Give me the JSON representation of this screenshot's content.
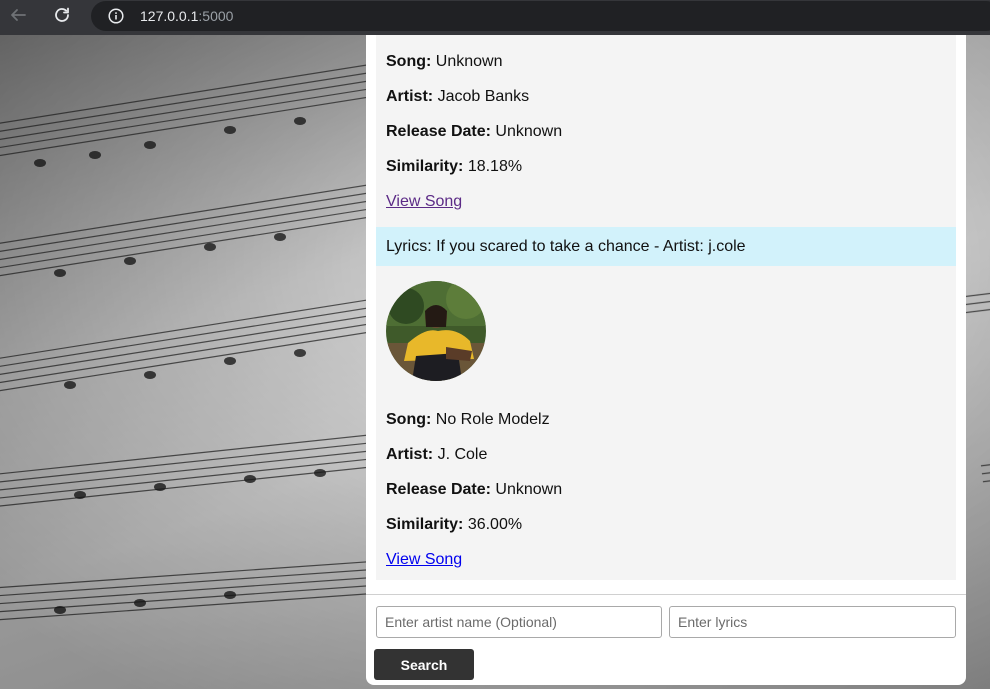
{
  "browser": {
    "url_host": "127.0.0.1",
    "url_port": ":5000",
    "icons": {
      "back": "arrow-left-icon",
      "reload": "reload-icon",
      "info": "info-icon"
    }
  },
  "results": [
    {
      "song_label": "Song:",
      "song": "Unknown",
      "artist_label": "Artist:",
      "artist": "Jacob Banks",
      "release_label": "Release Date:",
      "release": "Unknown",
      "similarity_label": "Similarity:",
      "similarity": "18.18%",
      "view_link": "View Song"
    },
    {
      "header": "Lyrics: If you scared to take a chance - Artist: j.cole",
      "song_label": "Song:",
      "song": "No Role Modelz",
      "artist_label": "Artist:",
      "artist": "J. Cole",
      "release_label": "Release Date:",
      "release": "Unknown",
      "similarity_label": "Similarity:",
      "similarity": "36.00%",
      "view_link": "View Song"
    }
  ],
  "search": {
    "artist_placeholder": "Enter artist name (Optional)",
    "artist_value": "",
    "lyrics_placeholder": "Enter lyrics",
    "lyrics_value": "",
    "button_label": "Search"
  },
  "colors": {
    "highlight": "#d2f2fb",
    "panel": "#f4f4f4",
    "button": "#333333",
    "visited_link": "#5b2a86",
    "link": "#0000ee"
  }
}
